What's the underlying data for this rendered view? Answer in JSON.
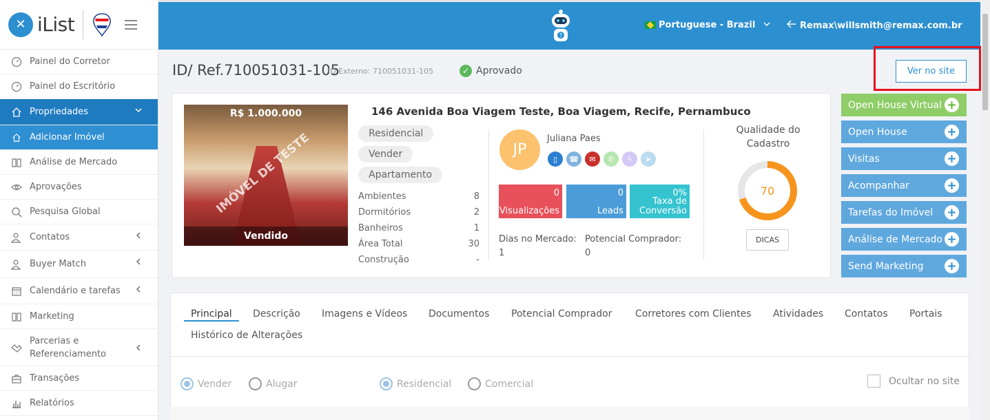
{
  "brand": {
    "name": "iList"
  },
  "sidebar": {
    "items": [
      {
        "label": "Painel do Corretor",
        "icon": "gauge-icon"
      },
      {
        "label": "Painel do Escritório",
        "icon": "gauge-icon"
      },
      {
        "label": "Propriedades",
        "icon": "home-icon"
      },
      {
        "label": "Adicionar Imóvel",
        "icon": "home-icon"
      },
      {
        "label": "Análise de Mercado",
        "icon": "book-icon"
      },
      {
        "label": "Aprovações",
        "icon": "eye-icon"
      },
      {
        "label": "Pesquisa Global",
        "icon": "search-icon"
      },
      {
        "label": "Contatos",
        "icon": "contacts-icon"
      },
      {
        "label": "Buyer Match",
        "icon": "buyer-icon"
      },
      {
        "label": "Calendário e tarefas",
        "icon": "calendar-icon"
      },
      {
        "label": "Marketing",
        "icon": "book-icon"
      },
      {
        "label": "Parcerias e Referenciamento",
        "icon": "handshake-icon"
      },
      {
        "label": "Transações",
        "icon": "briefcase-icon"
      },
      {
        "label": "Relatórios",
        "icon": "bar-chart-icon"
      }
    ]
  },
  "topbar": {
    "language": "Portuguese - Brazil",
    "user": "Remax\\willsmith@remax.com.br"
  },
  "header": {
    "id_ref": "ID/ Ref.710051031-105",
    "id_externo": "ID Externo: 710051031-105",
    "status": "Aprovado",
    "ver_site": "Ver no site"
  },
  "property": {
    "price": "R$ 1.000.000",
    "watermark": "IMÓVEL DE TESTE",
    "sold_label": "Vendido",
    "address": "146 Avenida Boa Viagem Teste, Boa Viagem, Recife, Pernambuco",
    "tags": [
      "Residencial",
      "Vender",
      "Apartamento"
    ],
    "features": [
      {
        "label": "Ambientes",
        "value": "8"
      },
      {
        "label": "Dormitórios",
        "value": "2"
      },
      {
        "label": "Banheiros",
        "value": "1"
      },
      {
        "label": "Área Total",
        "value": "30"
      },
      {
        "label": "Construção",
        "value": "-"
      }
    ]
  },
  "agent": {
    "initials": "JP",
    "name": "Juliana Paes",
    "stats": [
      {
        "value": "0",
        "label": "Visualizações",
        "color": "#e8505b"
      },
      {
        "value": "0",
        "label": "Leads",
        "color": "#4b9cd8"
      },
      {
        "value": "0%",
        "label": "Taxa de Conversão",
        "color": "#35c3cf"
      }
    ],
    "dias_label": "Dias no Mercado:",
    "dias_value": "1",
    "potencial_label": "Potencial Comprador:",
    "potencial_value": "0"
  },
  "quality": {
    "label": "Qualidade do Cadastro",
    "score": "70",
    "fraction": 0.7,
    "color": "#f7941d",
    "button": "DICAS"
  },
  "actions": [
    {
      "label": "Open House Virtual"
    },
    {
      "label": "Open House"
    },
    {
      "label": "Visitas"
    },
    {
      "label": "Acompanhar"
    },
    {
      "label": "Tarefas do Imóvel"
    },
    {
      "label": "Análise de Mercado"
    },
    {
      "label": "Send Marketing"
    }
  ],
  "tabs": [
    "Principal",
    "Descrição",
    "Imagens e Vídeos",
    "Documentos",
    "Potencial Comprador",
    "Corretores com Clientes",
    "Atividades",
    "Contatos",
    "Portais",
    "Histórico de Alterações"
  ],
  "form": {
    "vender": "Vender",
    "alugar": "Alugar",
    "residencial": "Residencial",
    "comercial": "Comercial",
    "ocultar": "Ocultar no site"
  },
  "colors": {
    "primary": "#2b8fd0",
    "sidebar_active": "#1f7bc0",
    "green": "#8fcd68",
    "highlight": "#e8101c"
  }
}
